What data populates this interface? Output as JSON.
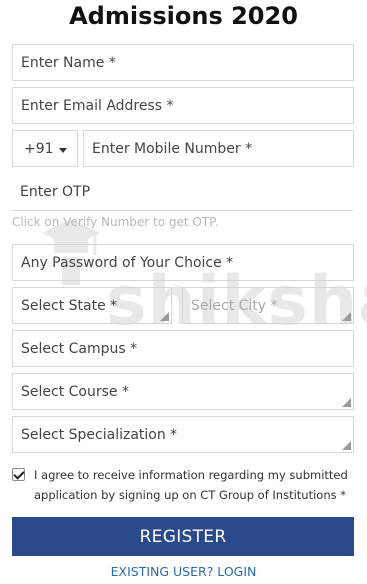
{
  "page": {
    "title": "Admissions 2020"
  },
  "watermark": {
    "text": "shiksha",
    "icon": "graduation-cap-icon"
  },
  "form": {
    "name_placeholder": "Enter Name *",
    "email_placeholder": "Enter Email Address *",
    "country_code": "+91",
    "mobile_placeholder": "Enter Mobile Number *",
    "otp_placeholder": "Enter OTP",
    "otp_hint": "Click on Verify Number to get OTP.",
    "password_placeholder": "Any Password of Your Choice *",
    "state_placeholder": "Select State *",
    "city_placeholder": "Select City *",
    "campus_placeholder": "Select Campus *",
    "course_placeholder": "Select Course *",
    "specialization_placeholder": "Select Specialization *",
    "consent_checked": true,
    "consent_text": "I agree to receive information regarding my submitted application by signing up on CT Group of Institutions *",
    "register_label": "REGISTER",
    "login_link": "EXISTING USER? LOGIN"
  },
  "colors": {
    "button": "#2a4a8b",
    "link": "#2a6ab0"
  }
}
